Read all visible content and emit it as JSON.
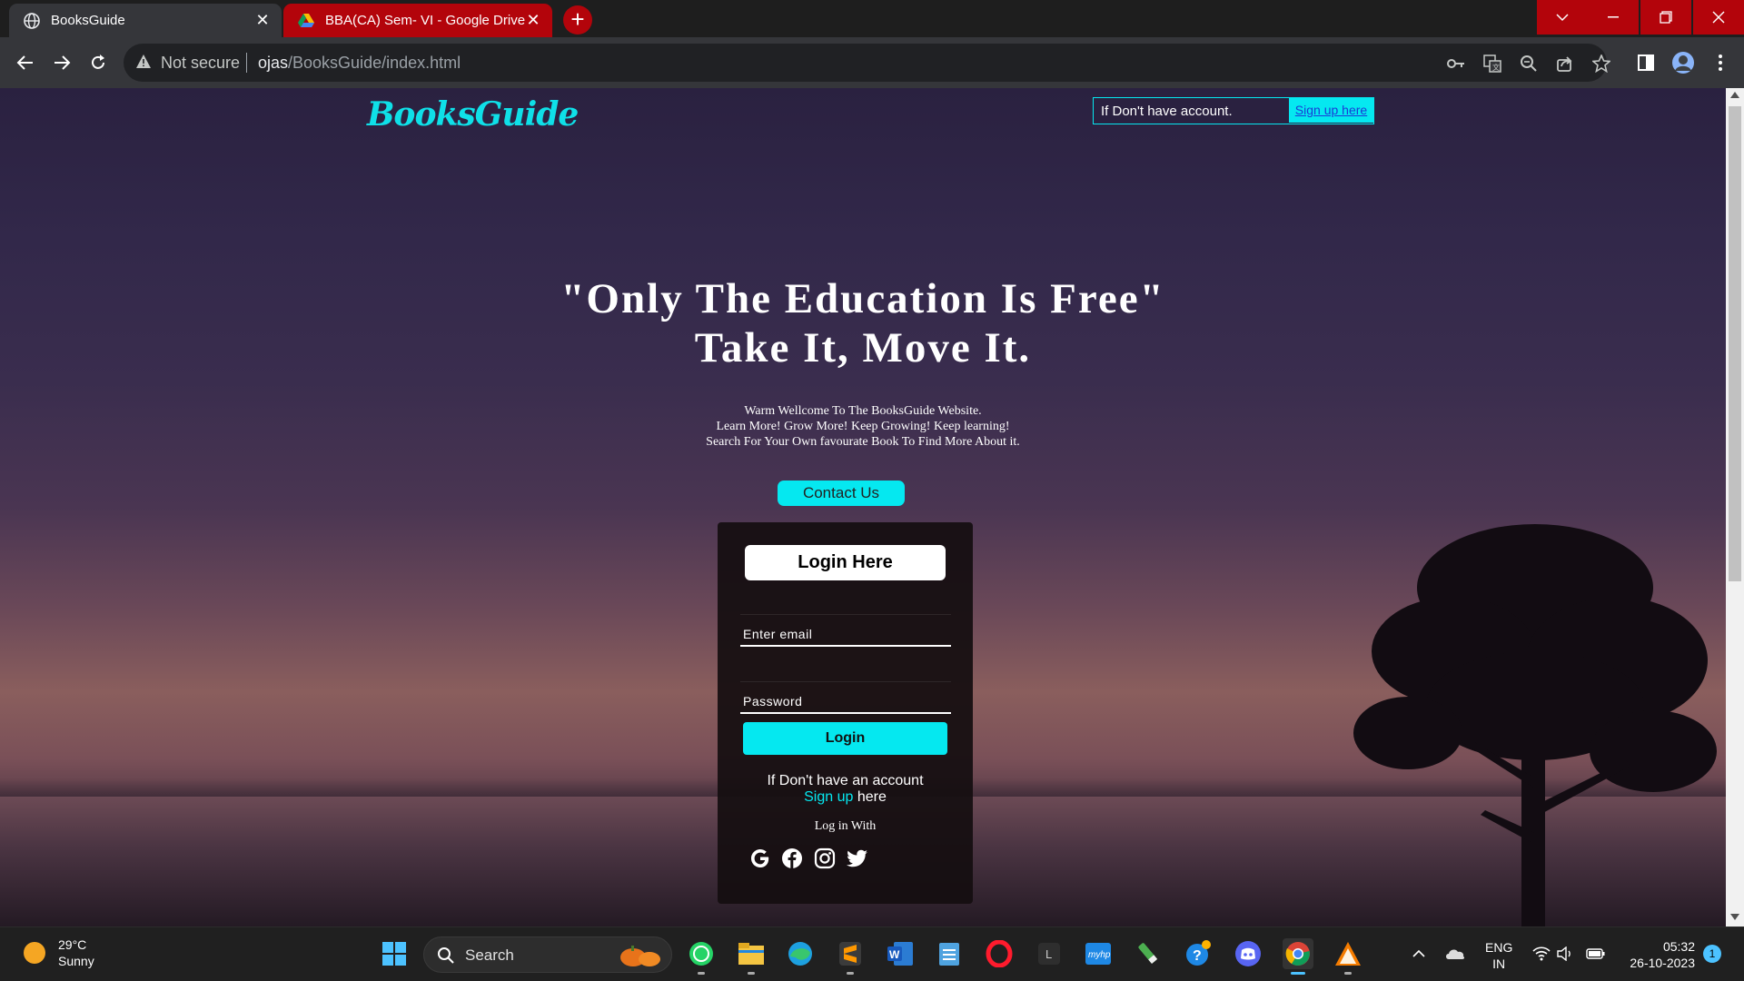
{
  "browser": {
    "tabs": [
      {
        "title": "BooksGuide",
        "active": true
      },
      {
        "title": "BBA(CA) Sem- VI - Google Drive",
        "active": false
      }
    ],
    "address": {
      "security": "Not secure",
      "host": "ojas",
      "path": "/BooksGuide/index.html"
    },
    "accent": "#b3040b"
  },
  "page": {
    "logo": "BooksGuide",
    "top_signup": {
      "text": "If Don't have account.",
      "link": "Sign up here"
    },
    "hero_line1": "\"Only The Education Is Free\"",
    "hero_line2": "Take It, Move It.",
    "welcome": [
      "Warm Wellcome To The BooksGuide Website.",
      "Learn More! Grow More! Keep Growing! Keep learning!",
      "Search For Your Own favourate Book To Find More About it."
    ],
    "contact_button": "Contact Us",
    "login": {
      "title": "Login Here",
      "email_placeholder": "Enter email",
      "password_placeholder": "Password",
      "login_button": "Login",
      "no_account": "If Don't have an account",
      "signup_link": "Sign up",
      "signup_suffix": " here",
      "login_with": "Log in With",
      "social_icons": [
        "google-icon",
        "facebook-icon",
        "instagram-icon",
        "twitter-icon"
      ]
    },
    "accent_color": "#05e8f0"
  },
  "taskbar": {
    "weather": {
      "temp": "29°C",
      "condition": "Sunny"
    },
    "search_label": "Search",
    "lang": {
      "line1": "ENG",
      "line2": "IN"
    },
    "time": "05:32",
    "date": "26-10-2023",
    "notification_count": "1"
  }
}
